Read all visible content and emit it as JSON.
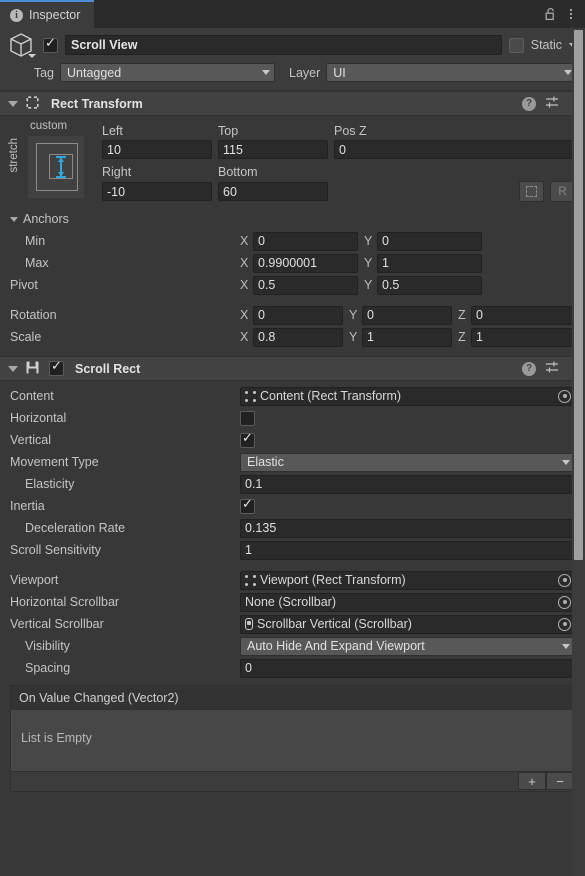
{
  "window": {
    "tab_label": "Inspector",
    "tab_icon": "info-icon",
    "lock_icon": "padlock-open-icon",
    "menu_icon": "kebab-menu-icon",
    "accent_color": "#4a8cd8",
    "background_color": "#383838"
  },
  "gameobject": {
    "icon": "cube-icon",
    "enabled": true,
    "name": "Scroll View",
    "static_label": "Static",
    "static_checked": false,
    "tag_label": "Tag",
    "tag_value": "Untagged",
    "layer_label": "Layer",
    "layer_value": "UI"
  },
  "rect_transform": {
    "title": "Rect Transform",
    "expanded": true,
    "icon": "rect-transform-icon",
    "help_icon": "help-icon",
    "preset_icon": "preset-settings-icon",
    "menu_icon": "kebab-menu-icon",
    "anchor_preset": {
      "horizontal_label": "custom",
      "vertical_label": "stretch",
      "arrow_color": "#2fa8e0"
    },
    "fields": {
      "left_label": "Left",
      "left_value": "10",
      "top_label": "Top",
      "top_value": "115",
      "posz_label": "Pos Z",
      "posz_value": "0",
      "right_label": "Right",
      "right_value": "-10",
      "bottom_label": "Bottom",
      "bottom_value": "60"
    },
    "blueprint_button": "blueprint-mode-button",
    "raw_button_label": "R",
    "anchors_label": "Anchors",
    "anchors_expanded": true,
    "min_label": "Min",
    "min_x": "0",
    "min_y": "0",
    "max_label": "Max",
    "max_x": "0.9900001",
    "max_y": "1",
    "pivot_label": "Pivot",
    "pivot_x": "0.5",
    "pivot_y": "0.5",
    "rotation_label": "Rotation",
    "rotation_x": "0",
    "rotation_y": "0",
    "rotation_z": "0",
    "scale_label": "Scale",
    "scale_x": "0.8",
    "scale_y": "1",
    "scale_z": "1",
    "axis_x": "X",
    "axis_y": "Y",
    "axis_z": "Z"
  },
  "scroll_rect": {
    "title": "Scroll Rect",
    "expanded": true,
    "icon": "script-component-icon",
    "enabled": true,
    "help_icon": "help-icon",
    "preset_icon": "preset-settings-icon",
    "menu_icon": "kebab-menu-icon",
    "rows": [
      {
        "label": "Content",
        "type": "object",
        "value": "Content (Rect Transform)",
        "icon": "rect-transform-icon",
        "indent": 0
      },
      {
        "label": "Horizontal",
        "type": "checkbox",
        "checked": false,
        "indent": 0
      },
      {
        "label": "Vertical",
        "type": "checkbox",
        "checked": true,
        "indent": 0
      },
      {
        "label": "Movement Type",
        "type": "popup",
        "value": "Elastic",
        "indent": 0
      },
      {
        "label": "Elasticity",
        "type": "number",
        "value": "0.1",
        "indent": 1
      },
      {
        "label": "Inertia",
        "type": "checkbox",
        "checked": true,
        "indent": 0
      },
      {
        "label": "Deceleration Rate",
        "type": "number",
        "value": "0.135",
        "indent": 1
      },
      {
        "label": "Scroll Sensitivity",
        "type": "number",
        "value": "1",
        "indent": 0
      },
      {
        "label": "",
        "type": "gap",
        "indent": 0
      },
      {
        "label": "Viewport",
        "type": "object",
        "value": "Viewport (Rect Transform)",
        "icon": "rect-transform-icon",
        "indent": 0
      },
      {
        "label": "Horizontal Scrollbar",
        "type": "object",
        "value": "None (Scrollbar)",
        "icon": "none",
        "indent": 0
      },
      {
        "label": "Vertical Scrollbar",
        "type": "object",
        "value": "Scrollbar Vertical (Scrollbar)",
        "icon": "scrollbar-icon",
        "indent": 0
      },
      {
        "label": "Visibility",
        "type": "popup",
        "value": "Auto Hide And Expand Viewport",
        "indent": 1
      },
      {
        "label": "Spacing",
        "type": "number",
        "value": "0",
        "indent": 1
      }
    ],
    "event": {
      "header": "On Value Changed (Vector2)",
      "empty_text": "List is Empty",
      "add_label": "+",
      "remove_label": "−"
    }
  }
}
